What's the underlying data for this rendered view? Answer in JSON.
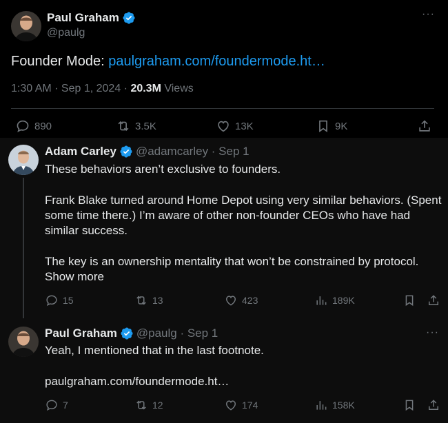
{
  "main_tweet": {
    "author_name": "Paul Graham",
    "handle": "@paulg",
    "text_prefix": "Founder Mode: ",
    "link_text": "paulgraham.com/foundermode.ht…",
    "timestamp": "1:30 AM · Sep 1, 2024 · ",
    "views_count": "20.3M",
    "views_label": " Views",
    "more_label": "···",
    "actions": {
      "replies": "890",
      "reposts": "3.5K",
      "likes": "13K",
      "bookmarks": "9K"
    }
  },
  "reply1": {
    "author_name": "Adam Carley",
    "handle_time": "@adamcarley · Sep 1",
    "lines": [
      "These behaviors aren’t exclusive to founders.",
      "Frank Blake turned around Home Depot using very similar behaviors. (Spent",
      "some time there.) I’m aware of other non-founder CEOs who have had",
      "similar success.",
      "The key is an ownership mentality that won’t be constrained by protocol."
    ],
    "show_more": "Show more",
    "actions": {
      "replies": "15",
      "reposts": "13",
      "likes": "423",
      "views": "189K"
    }
  },
  "reply2": {
    "author_name": "Paul Graham",
    "handle_time": "@paulg · Sep 1",
    "text": "Yeah, I mentioned that in the last footnote.",
    "link_text": "paulgraham.com/foundermode.ht…",
    "more_label": "···",
    "actions": {
      "replies": "7",
      "reposts": "12",
      "likes": "174",
      "views": "158K"
    }
  },
  "colors": {
    "background": "#000000",
    "reply_background": "#0d0d0d",
    "text": "#e7e9ea",
    "muted": "#71767b",
    "link": "#1d9bf0",
    "verified": "#1d9bf0"
  }
}
